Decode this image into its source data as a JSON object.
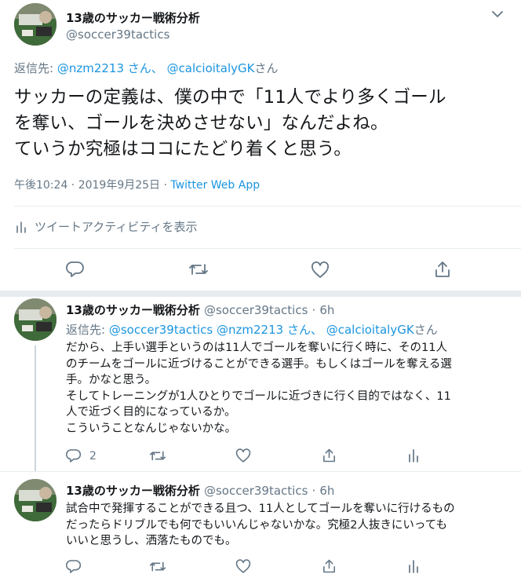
{
  "main_tweet": {
    "display_name": "13歳のサッカー戦術分析",
    "handle": "@soccer39tactics",
    "reply_prefix": "返信先:",
    "reply_mention_1": "@nzm2213 さん、",
    "reply_mention_2": "@calcioitalyGK",
    "reply_suffix": "さん",
    "text_line_1": "サッカーの定義は、僕の中で「11人でより多くゴール",
    "text_line_2": "を奪い、ゴールを決めさせない」なんだよね。",
    "text_line_3": "ていうか究極はココにたどり着くと思う。",
    "timestamp": "午後10:24 · 2019年9月25日 · ",
    "source": "Twitter Web App",
    "activity_label": "ツイートアクティビティを表示"
  },
  "replies": [
    {
      "display_name": "13歳のサッカー戦術分析",
      "handle": "@soccer39tactics",
      "separator": "·",
      "time": "6h",
      "reply_prefix": "返信先:",
      "reply_mentions": "@soccer39tactics @nzm2213 さん、",
      "reply_mention_2": "@calcioitalyGK",
      "reply_suffix": "さん",
      "lines": [
        "だから、上手い選手というのは11人でゴールを奪いに行く時に、その11人",
        "のチームをゴールに近づけることができる選手。もしくはゴールを奪える選",
        "手。かなと思う。",
        "そしてトレーニングが1人ひとりでゴールに近づきに行く目的ではなく、11",
        "人で近づく目的になっているか。",
        "こういうことなんじゃないかな。"
      ],
      "reply_count": "2"
    },
    {
      "display_name": "13歳のサッカー戦術分析",
      "handle": "@soccer39tactics",
      "separator": "·",
      "time": "6h",
      "lines": [
        "試合中で発揮することができる且つ、11人としてゴールを奪いに行けるもの",
        "だったらドリブルでも何でもいいんじゃないかな。究極2人抜きにいっても",
        "いいと思うし、洒落たものでも。"
      ]
    }
  ],
  "icons": [
    "chevron-down-icon",
    "bar-chart-icon",
    "reply-icon",
    "retweet-icon",
    "like-icon",
    "share-icon"
  ],
  "colors": {
    "link": "#1b95e0",
    "muted": "#657786",
    "divider": "#e6ecf0"
  }
}
